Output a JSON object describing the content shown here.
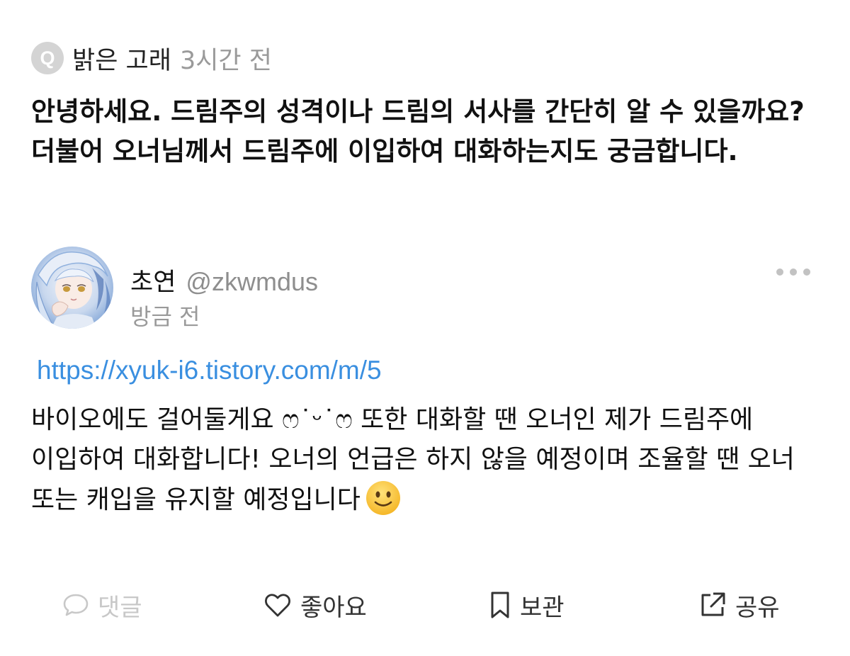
{
  "question": {
    "badge": "Q",
    "author": "밝은 고래",
    "time": "3시간 전",
    "text": "안녕하세요. 드림주의 성격이나 드림의 서사를 간단히 알 수 있을까요? 더불어 오너님께서 드림주에 이입하여 대화하는지도 궁금합니다."
  },
  "answer": {
    "name": "초연",
    "handle": "@zkwmdus",
    "time": "방금 전",
    "link": "https://xyuk-i6.tistory.com/m/5",
    "body": "바이오에도 걸어둘게요 ෆ˙ᵕ˙ෆ 또한 대화할 땐 오너인 제가 드림주에 이입하여 대화합니다! 오너의 언급은 하지 않을 예정이며 조율할 땐 오너 또는 캐입을 유지할 예정입니다",
    "emoji": "slightly-smiling-face"
  },
  "actions": {
    "comment": "댓글",
    "like": "좋아요",
    "save": "보관",
    "share": "공유"
  },
  "colors": {
    "link": "#3a8fe0",
    "muted": "#9a9a9a",
    "disabled": "#c8c8c8",
    "text": "#111111",
    "badge": "#d4d4d4"
  },
  "icons": {
    "question_badge": "q-badge-icon",
    "more": "more-dots-icon",
    "comment": "comment-bubble-icon",
    "like": "heart-icon",
    "save": "bookmark-icon",
    "share": "share-icon"
  }
}
